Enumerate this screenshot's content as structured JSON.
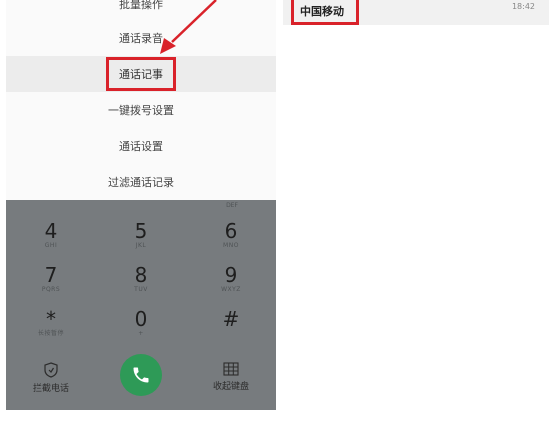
{
  "menu": {
    "items": [
      {
        "label": "批量操作"
      },
      {
        "label": "通话录音"
      },
      {
        "label": "通话记事"
      },
      {
        "label": "一键拨号设置"
      },
      {
        "label": "通话设置"
      },
      {
        "label": "过滤通话记录"
      }
    ]
  },
  "keypad": {
    "partial_letters": "DEF",
    "keys": [
      {
        "digit": "4",
        "letters": "GHI"
      },
      {
        "digit": "5",
        "letters": "JKL"
      },
      {
        "digit": "6",
        "letters": "MNO"
      },
      {
        "digit": "7",
        "letters": "PQRS"
      },
      {
        "digit": "8",
        "letters": "TUV"
      },
      {
        "digit": "9",
        "letters": "WXYZ"
      },
      {
        "digit": "*",
        "letters": "长按暂停"
      },
      {
        "digit": "0",
        "letters": "+"
      },
      {
        "digit": "#",
        "letters": ""
      }
    ]
  },
  "bottom": {
    "block_label": "拦截电话",
    "keyboard_label": "收起键盘"
  },
  "right": {
    "carrier": "中国移动",
    "time": "18:42"
  },
  "colors": {
    "highlight": "#d9222a",
    "call_button": "#2e9a57",
    "keypad_bg": "#777b7e"
  }
}
